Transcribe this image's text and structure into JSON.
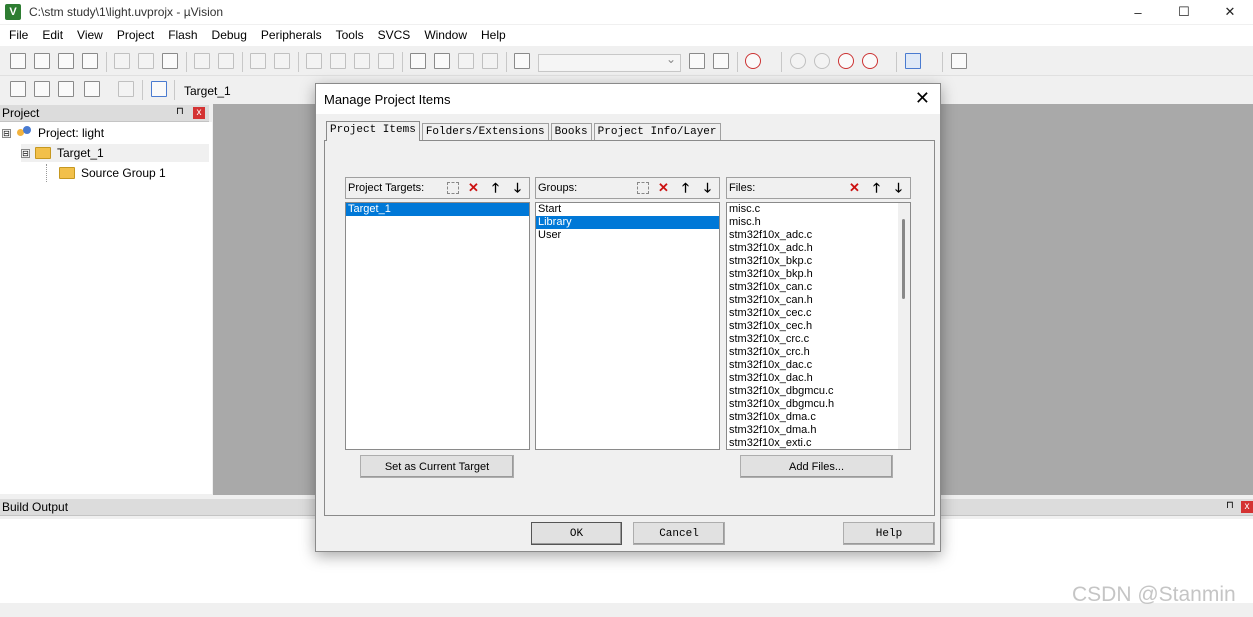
{
  "window": {
    "title": "C:\\stm study\\1\\light.uvprojx - µVision",
    "icon_label": "V",
    "controls": [
      "–",
      "☐",
      "✕"
    ]
  },
  "menu": [
    "File",
    "Edit",
    "View",
    "Project",
    "Flash",
    "Debug",
    "Peripherals",
    "Tools",
    "SVCS",
    "Window",
    "Help"
  ],
  "toolbar": {
    "target_name": "Target_1"
  },
  "project_panel": {
    "title": "Project",
    "pin": "⊓",
    "close": "x",
    "tree": [
      {
        "label": "Project: light",
        "toggle": "⊟"
      },
      {
        "label": "Target_1",
        "toggle": "⊟"
      },
      {
        "label": "Source Group 1",
        "toggle": ""
      }
    ]
  },
  "build_output": {
    "title": "Build Output",
    "pin": "⊓",
    "close": "x"
  },
  "watermark": "CSDN @Stanmin",
  "dialog": {
    "title": "Manage Project Items",
    "close": "✕",
    "tabs": [
      "Project Items",
      "Folders/Extensions",
      "Books",
      "Project Info/Layer"
    ],
    "active_tab": "Project Items",
    "targets": {
      "label": "Project Targets:",
      "items": [
        "Target_1"
      ],
      "selected": "Target_1",
      "button": "Set as Current Target"
    },
    "groups": {
      "label": "Groups:",
      "items": [
        "Start",
        "Library",
        "User"
      ],
      "selected": "Library"
    },
    "files": {
      "label": "Files:",
      "items": [
        "misc.c",
        "misc.h",
        "stm32f10x_adc.c",
        "stm32f10x_adc.h",
        "stm32f10x_bkp.c",
        "stm32f10x_bkp.h",
        "stm32f10x_can.c",
        "stm32f10x_can.h",
        "stm32f10x_cec.c",
        "stm32f10x_cec.h",
        "stm32f10x_crc.c",
        "stm32f10x_crc.h",
        "stm32f10x_dac.c",
        "stm32f10x_dac.h",
        "stm32f10x_dbgmcu.c",
        "stm32f10x_dbgmcu.h",
        "stm32f10x_dma.c",
        "stm32f10x_dma.h",
        "stm32f10x_exti.c"
      ],
      "button": "Add Files..."
    },
    "header_buttons": {
      "new": "",
      "delete": "✕",
      "up": "🡑",
      "down": "🡓"
    },
    "ok": "OK",
    "cancel": "Cancel",
    "help": "Help"
  }
}
